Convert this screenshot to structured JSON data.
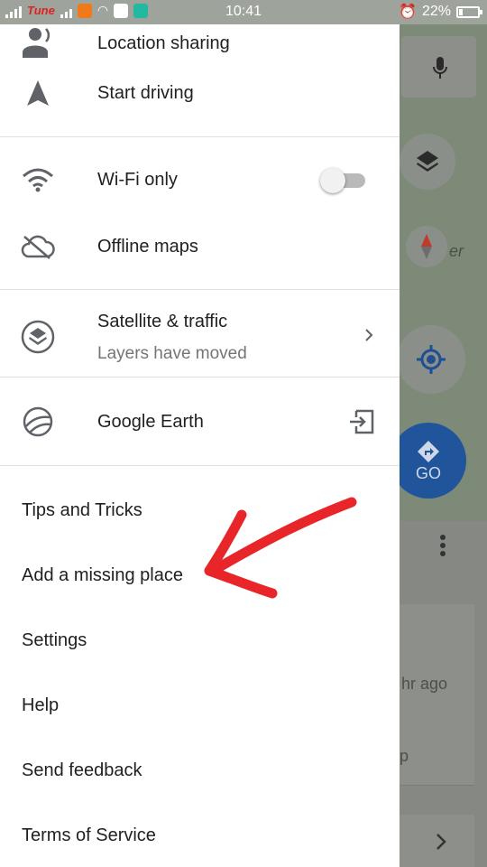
{
  "status_bar": {
    "carrier": "Tune",
    "time": "10:41",
    "battery": "22%",
    "battery_level": 0.22
  },
  "drawer": {
    "location_sharing": "Location sharing",
    "start_driving": "Start driving",
    "wifi_only": "Wi-Fi only",
    "wifi_only_enabled": false,
    "offline_maps": "Offline maps",
    "satellite_traffic": "Satellite & traffic",
    "layers_moved": "Layers have moved",
    "google_earth": "Google Earth",
    "links": [
      "Tips and Tricks",
      "Add a missing place",
      "Settings",
      "Help",
      "Send feedback",
      "Terms of Service"
    ]
  },
  "map": {
    "go_label": "GO",
    "partial_text_1": "er",
    "partial_text_2": "hr ago",
    "partial_text_3": "p"
  },
  "annotation": {
    "arrow_color": "#e8262a",
    "target": "Add a missing place"
  },
  "colors": {
    "drawer_bg": "#ffffff",
    "text_primary": "#212121",
    "text_secondary": "#757575",
    "go_button": "#20559c"
  }
}
